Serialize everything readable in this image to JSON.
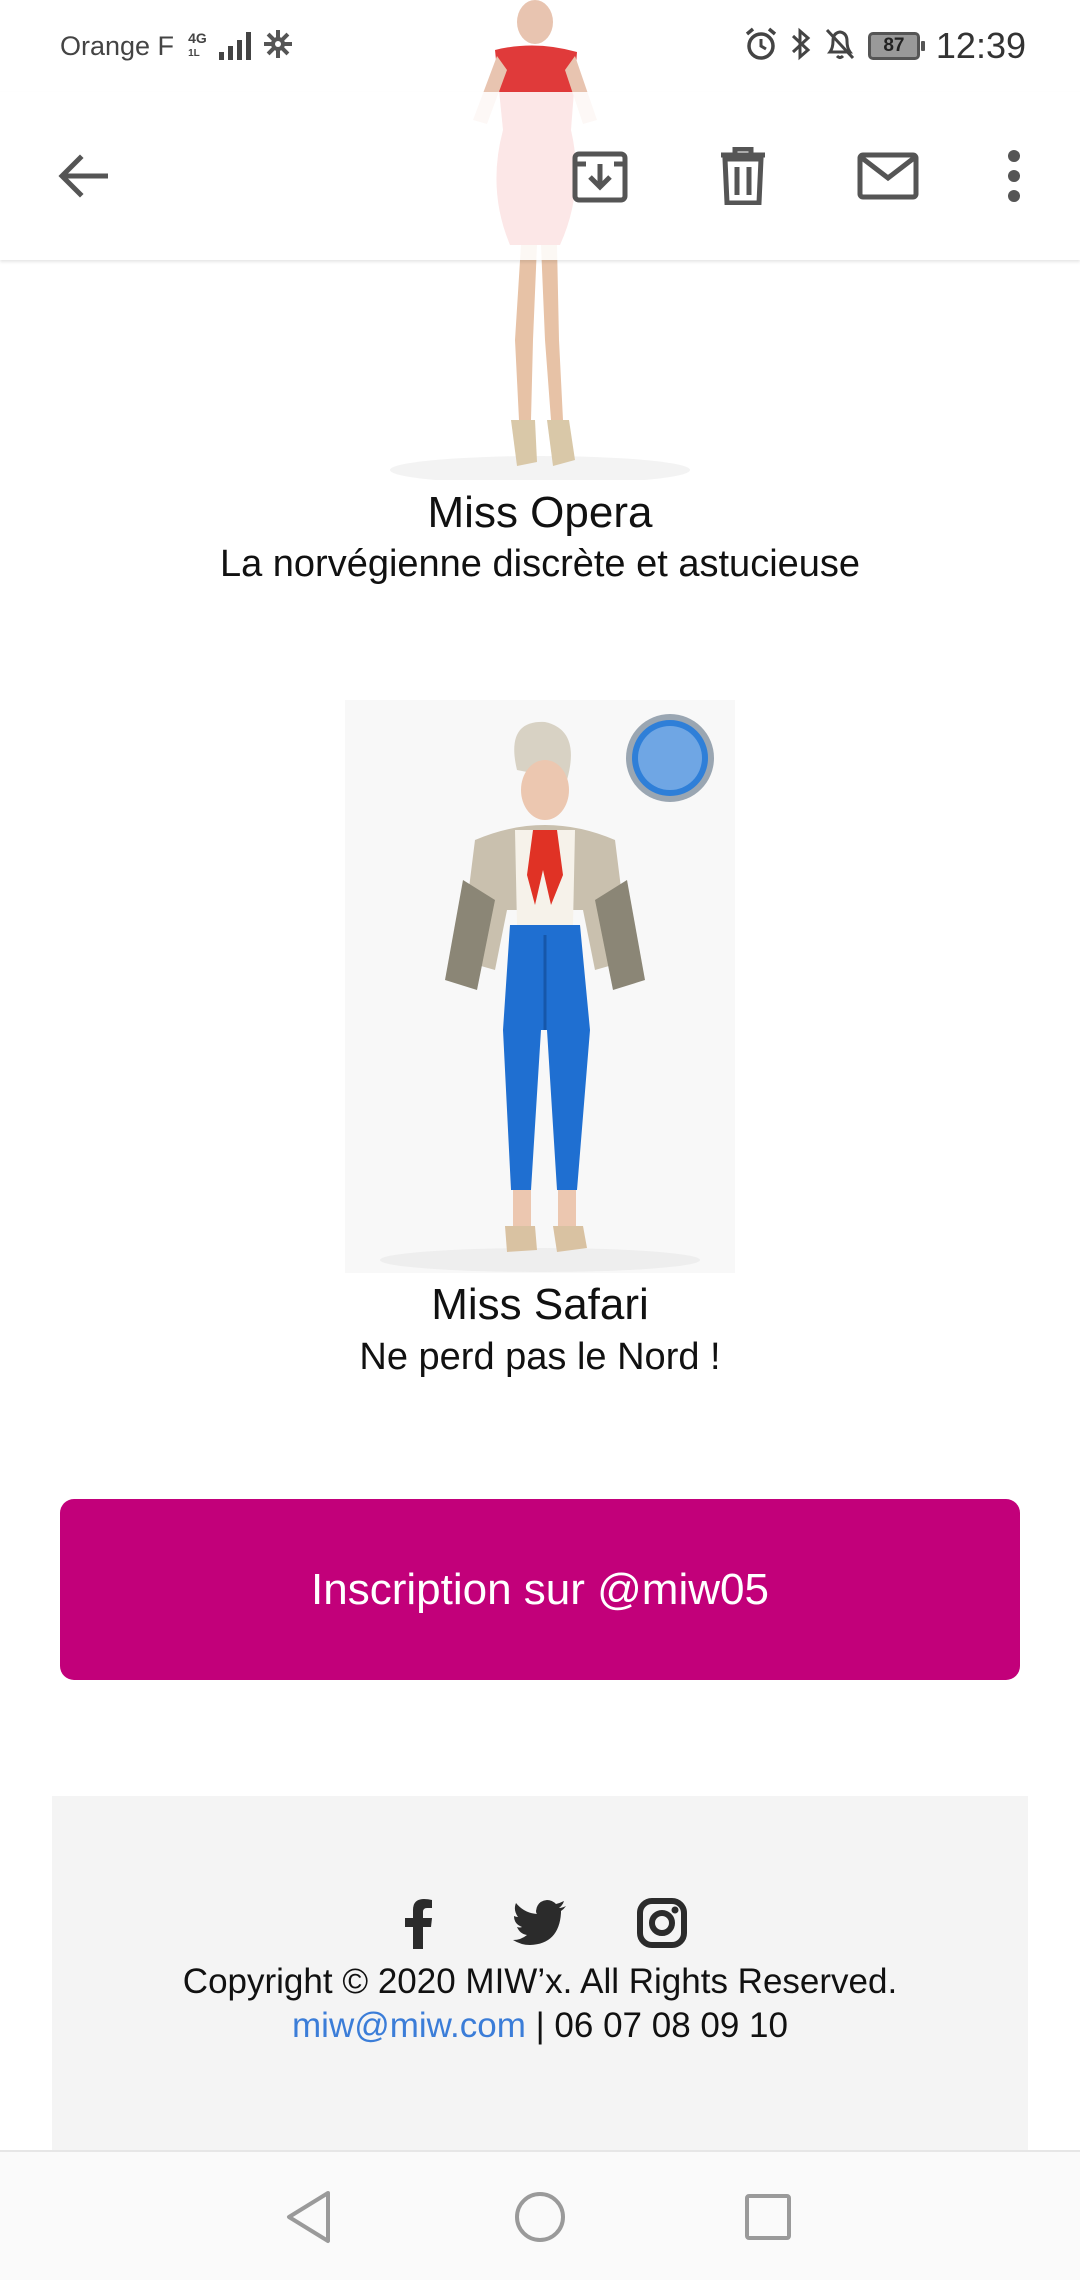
{
  "status_bar": {
    "carrier": "Orange F",
    "network_type": "4G",
    "network_sub": "1L",
    "battery_level": "87",
    "time": "12:39"
  },
  "app_bar": {
    "icons": [
      "back-arrow-icon",
      "archive-icon",
      "delete-icon",
      "mark-unread-icon",
      "more-options-icon"
    ]
  },
  "email": {
    "models": [
      {
        "name": "Miss Opera",
        "tagline": "La norvégienne discrète et astucieuse"
      },
      {
        "name": "Miss Safari",
        "tagline": "Ne perd pas le Nord !"
      }
    ],
    "cta_label": "Inscription sur @miw05",
    "footer": {
      "social": [
        "facebook-icon",
        "twitter-icon",
        "instagram-icon"
      ],
      "copyright": "Copyright © 2020 MIW’x. All Rights Reserved.",
      "email": "miw@miw.com",
      "separator": " | ",
      "phone": "06 07 08 09 10"
    }
  },
  "nav_bar": {
    "icons": [
      "nav-back-icon",
      "nav-home-icon",
      "nav-recents-icon"
    ]
  },
  "colors": {
    "cta_background": "#c2007a",
    "link": "#3b7dd8",
    "footer_background": "#f4f4f4"
  }
}
